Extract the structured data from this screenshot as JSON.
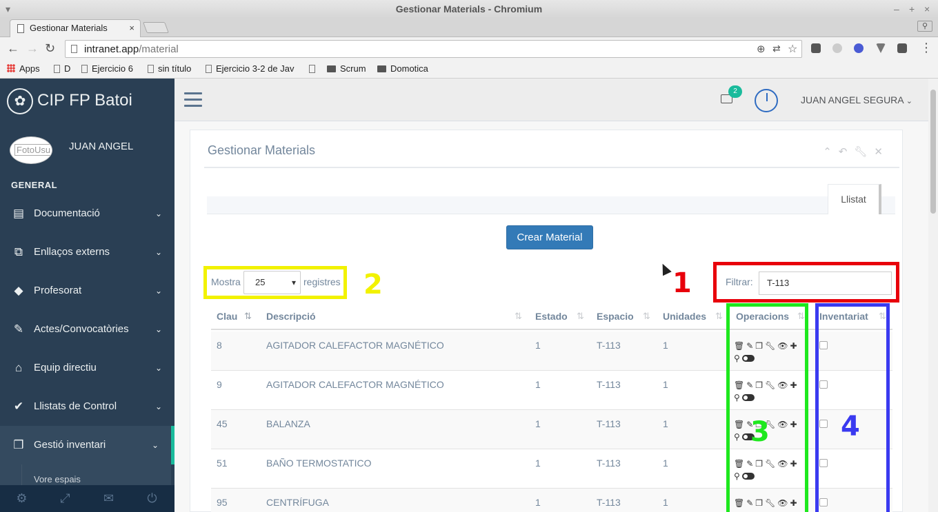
{
  "window": {
    "title": "Gestionar Materials - Chromium"
  },
  "browser": {
    "tab_title": "Gestionar Materials",
    "url_host": "intranet.app",
    "url_path": "/material",
    "bookmarks": [
      "Apps",
      "D",
      "Ejercicio 6",
      "sin título",
      "Ejercicio 3-2 de Jav",
      "",
      "Scrum",
      "Domotica"
    ]
  },
  "sidebar": {
    "brand": "CIP FP Batoi",
    "profile_alt": "FotoUsu",
    "profile_name": "JUAN ANGEL",
    "section": "GENERAL",
    "items": [
      {
        "label": "Documentació",
        "icon": "book-icon"
      },
      {
        "label": "Enllaços externs",
        "icon": "external-link-icon"
      },
      {
        "label": "Profesorat",
        "icon": "graduation-cap-icon"
      },
      {
        "label": "Actes/Convocatòries",
        "icon": "edit-icon"
      },
      {
        "label": "Equip directiu",
        "icon": "home-icon"
      },
      {
        "label": "Llistats de Control",
        "icon": "check-icon"
      },
      {
        "label": "Gestió inventari",
        "icon": "cubes-icon"
      }
    ],
    "submenu_item": "Vore espais",
    "footer_icons": [
      "settings-icon",
      "fullscreen-icon",
      "mail-icon",
      "power-icon"
    ]
  },
  "topnav": {
    "mail_count": "2",
    "user_name": "JUAN ANGEL SEGURA"
  },
  "panel": {
    "title": "Gestionar Materials",
    "tab": "Llistat",
    "create_button": "Crear Material",
    "show_label": "Mostra",
    "show_value": "25",
    "records_label": "registres",
    "filter_label": "Filtrar:",
    "filter_value": "T-113"
  },
  "table": {
    "headers": [
      "Clau",
      "Descripció",
      "Estado",
      "Espacio",
      "Unidades",
      "Operacions",
      "Inventariat"
    ],
    "rows": [
      {
        "clau": "8",
        "descripcio": "AGITADOR CALEFACTOR MAGNÉTICO",
        "estado": "1",
        "espacio": "T-113",
        "unidades": "1"
      },
      {
        "clau": "9",
        "descripcio": "AGITADOR CALEFACTOR MAGNÉTICO",
        "estado": "1",
        "espacio": "T-113",
        "unidades": "1"
      },
      {
        "clau": "45",
        "descripcio": "BALANZA",
        "estado": "1",
        "espacio": "T-113",
        "unidades": "1"
      },
      {
        "clau": "51",
        "descripcio": "BAÑO TERMOSTATICO",
        "estado": "1",
        "espacio": "T-113",
        "unidades": "1"
      },
      {
        "clau": "95",
        "descripcio": "CENTRÍFUGA",
        "estado": "1",
        "espacio": "T-113",
        "unidades": "1"
      }
    ]
  },
  "annotations": {
    "one": "1",
    "two": "2",
    "three": "3",
    "four": "4",
    "colors": {
      "one": "#e8000b",
      "two": "#f2f200",
      "three": "#1ee81e",
      "four": "#3a3af0"
    }
  }
}
